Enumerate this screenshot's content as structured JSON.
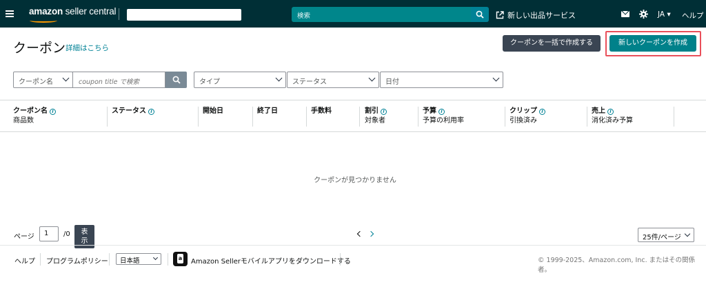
{
  "topbar": {
    "logo_main": "amazon",
    "logo_sub": " seller central",
    "search_placeholder": "検索",
    "new_listing": "新しい出品サービス",
    "language": "JA",
    "help": "ヘルプ",
    "colors": {
      "bar": "#002f36",
      "search": "#00868b",
      "accent": "#ff9900"
    }
  },
  "header": {
    "title": "クーポン",
    "details_link": "詳細はこちら",
    "bulk_create": "クーポンを一括で作成する",
    "create_new": "新しいクーポンを作成"
  },
  "filters": {
    "search_field": "クーポン名",
    "search_placeholder": "coupon title で検索",
    "type": "タイプ",
    "status": "ステータス",
    "date": "日付"
  },
  "table": {
    "columns": [
      {
        "main": "クーポン名",
        "sub": "商品数",
        "info": true
      },
      {
        "main": "ステータス",
        "sub": "",
        "info": true
      },
      {
        "main": "開始日",
        "sub": "",
        "info": false
      },
      {
        "main": "終了日",
        "sub": "",
        "info": false
      },
      {
        "main": "手数料",
        "sub": "",
        "info": false
      },
      {
        "main": "割引",
        "sub": "対象者",
        "info": true
      },
      {
        "main": "予算",
        "sub": "予算の利用率",
        "info": true
      },
      {
        "main": "クリップ",
        "sub": "引換済み",
        "info": true
      },
      {
        "main": "売上",
        "sub": "消化済み予算",
        "info": true
      }
    ],
    "empty_message": "クーポンが見つかりません"
  },
  "pagination": {
    "page_label": "ページ",
    "page_value": "1",
    "total": "/0",
    "show_line1": "表",
    "show_line2": "示",
    "per_page": "25件/ページ"
  },
  "footer": {
    "help": "ヘルプ",
    "policy": "プログラムポリシー",
    "language": "日本語",
    "app_download": "Amazon Sellerモバイルアプリをダウンロードする",
    "copyright": "© 1999-2025、Amazon.com, Inc. またはその関係者。"
  }
}
